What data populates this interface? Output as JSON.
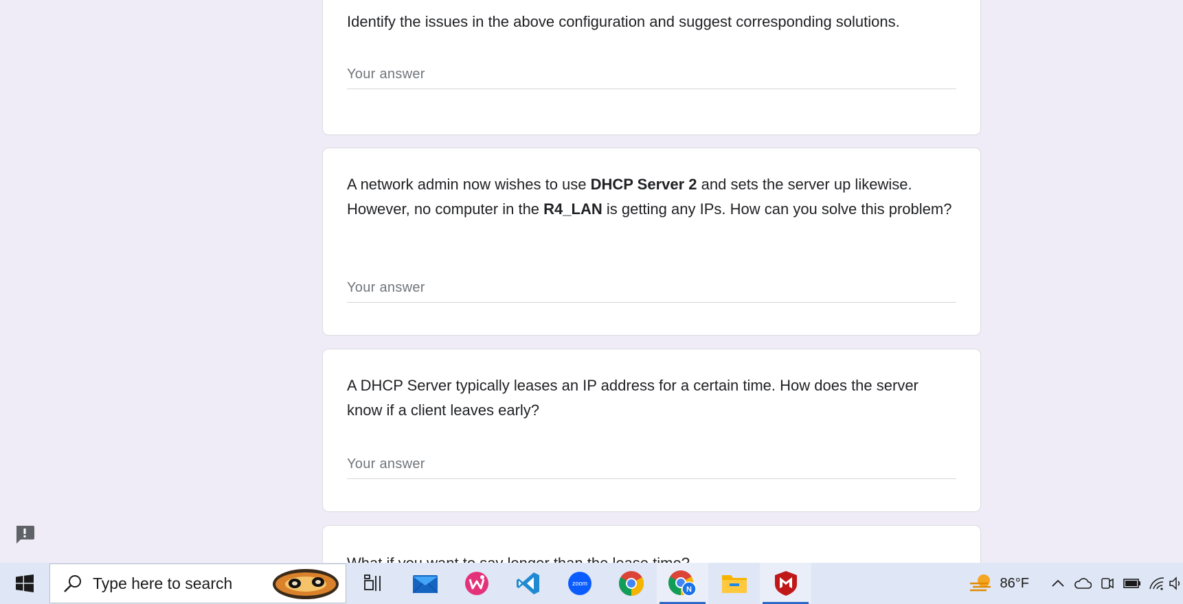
{
  "questions": [
    {
      "text": "Identify the issues in the above configuration and suggest corresponding solutions.",
      "placeholder": "Your answer"
    },
    {
      "text_parts": [
        "A network admin now wishes to use ",
        "DHCP Server 2",
        " and sets the server up likewise. However, no computer in the ",
        "R4_LAN",
        " is getting any IPs. How can you solve this problem?"
      ],
      "placeholder": "Your answer"
    },
    {
      "text": "A DHCP Server typically leases an IP address for a certain time. How does the server know if a client leaves early?",
      "placeholder": "Your answer"
    },
    {
      "text": "What if you want to say longer than the lease time?"
    }
  ],
  "taskbar": {
    "search_placeholder": "Type here to search",
    "apps": [
      "task-view",
      "mail",
      "wps-office",
      "vs-code",
      "zoom",
      "chrome",
      "chrome-profile",
      "file-explorer",
      "mcafee"
    ],
    "zoom_label": "zoom",
    "chrome_profile_badge": "N",
    "weather_temp": "86°F"
  }
}
